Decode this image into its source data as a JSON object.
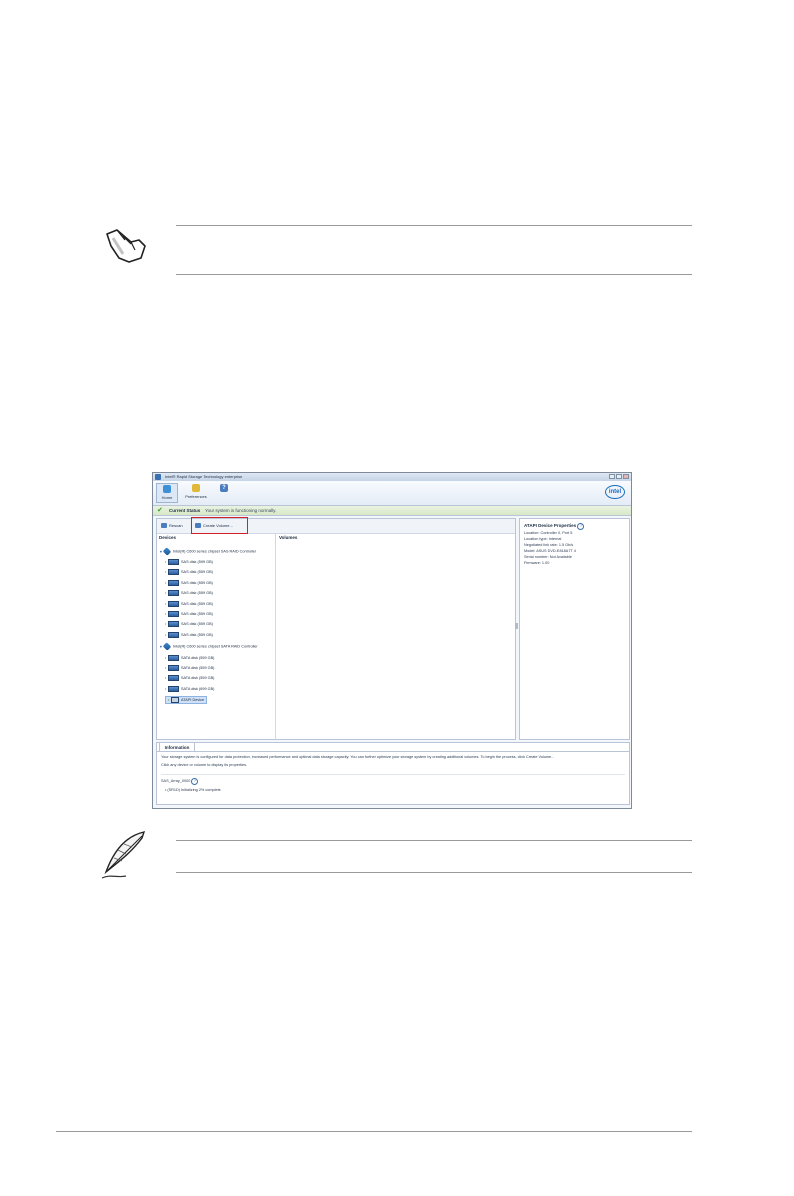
{
  "window": {
    "title": "Intel® Rapid Storage Technology enterprise"
  },
  "toolbar": {
    "home_label": "Home",
    "preferences_label": "Preferences",
    "help_icon": "help-icon",
    "logo_text": "intel"
  },
  "status": {
    "title": "Current Status",
    "message": "Your system is functioning normally."
  },
  "actions": {
    "rescan_label": "Rescan",
    "create_volume_label": "Create Volume..."
  },
  "highlight_color": "#d0202a",
  "columns": {
    "devices": "Devices",
    "volumes": "Volumes"
  },
  "tree": {
    "sas_controller": "Intel(R) C600 series chipset SAS RAID Controller",
    "sas_disks": [
      "SAS disk (599 GB)",
      "SAS disk (559 GB)",
      "SAS disk (559 GB)",
      "SAS disk (559 GB)",
      "SAS disk (559 GB)",
      "SAS disk (559 GB)",
      "SAS disk (559 GB)",
      "SAS disk (559 GB)"
    ],
    "sata_controller": "Intel(R) C600 series chipset SATA RAID Controller",
    "sata_disks": [
      "SATA disk (559 GB)",
      "SATA disk (559 GB)",
      "SATA disk (559 GB)",
      "SATA disk (699 GB)"
    ],
    "atapi_device": "ATAPI Device"
  },
  "properties": {
    "title": "ATAPI Device Properties",
    "lines": [
      "Location: Controller 0, Port 5",
      "Location type: Internal",
      "Negotiated link rate: 1.5 Gb/s",
      "Model: ASUS    DVD-E818A7T   4",
      "Serial number: Not Available",
      "Firmware: 1.00"
    ]
  },
  "information": {
    "tab_label": "Information",
    "text_1": "Your storage system is configured for data protection, increased performance and optimal data storage capacity. You can further optimize your storage system by creating additional volumes. To begin the process, click Create Volume...",
    "text_2": "Click any device or volume to display its properties.",
    "array_name": "SAS_Array_0000",
    "volume_status": "• (SR1D)  Initializing 2% complete"
  }
}
